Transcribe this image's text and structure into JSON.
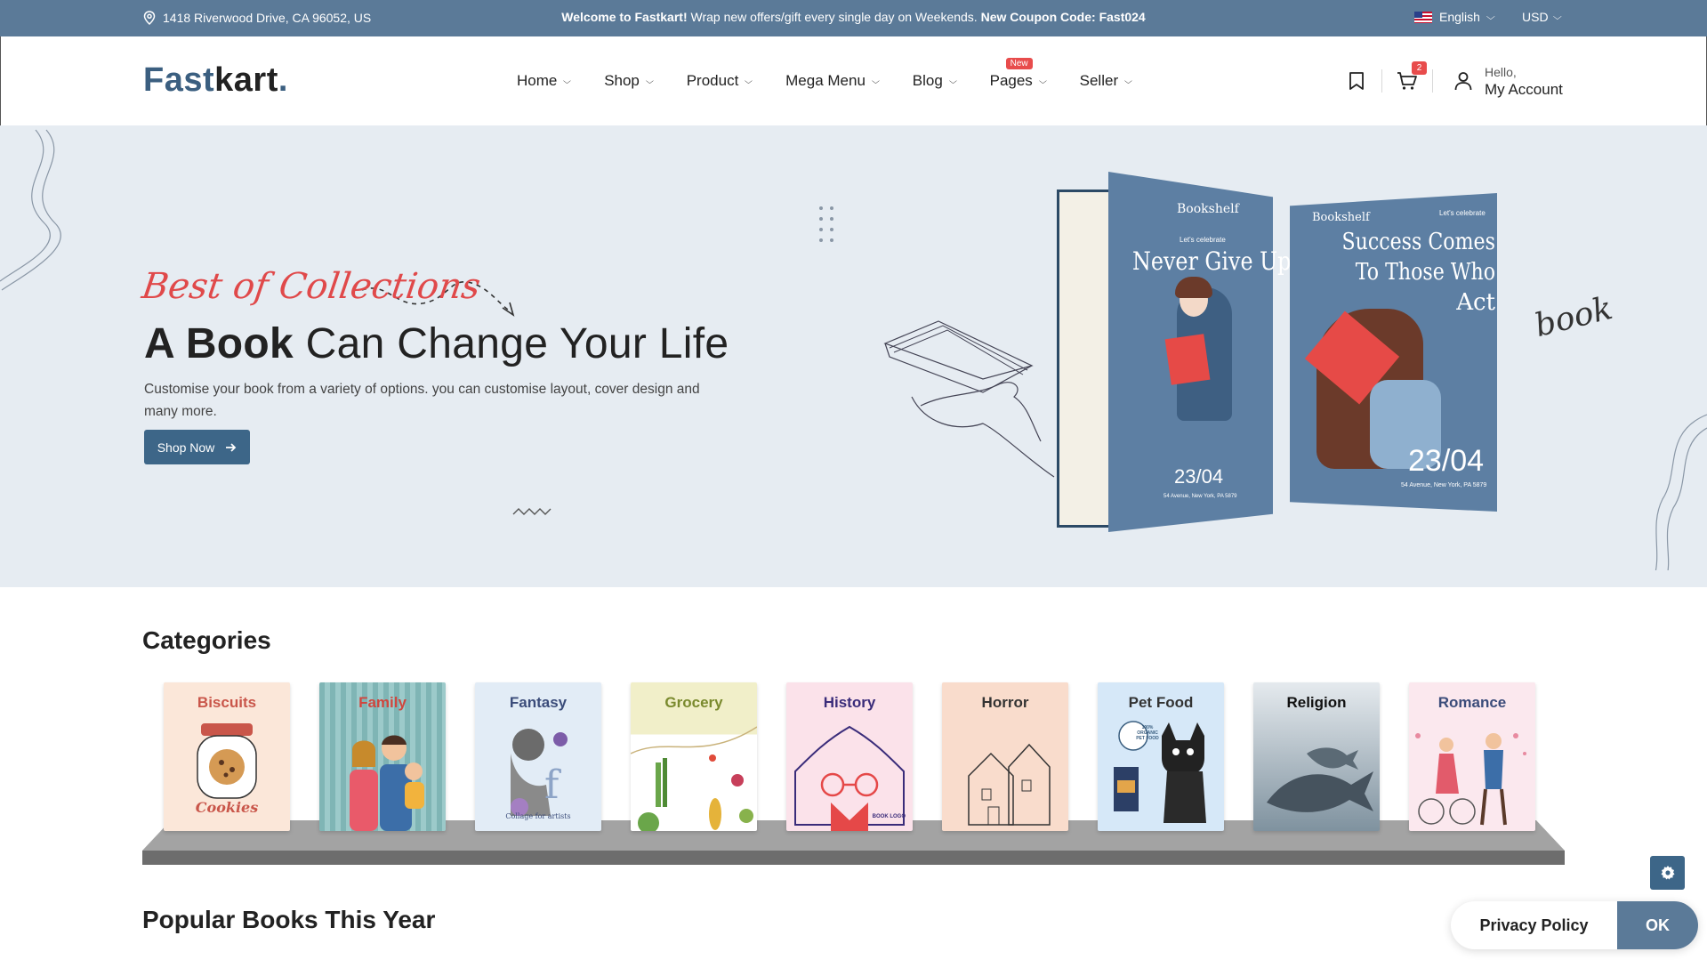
{
  "topbar": {
    "address": "1418 Riverwood Drive, CA 96052, US",
    "promo_bold": "Welcome to Fastkart!",
    "promo_text": "Wrap new offers/gift every single day on Weekends.",
    "promo_coupon": "New Coupon Code: Fast024",
    "language": "English",
    "currency": "USD"
  },
  "header": {
    "logo_part1": "Fast",
    "logo_part2": "kart",
    "logo_dot": ".",
    "nav": [
      {
        "label": "Home"
      },
      {
        "label": "Shop"
      },
      {
        "label": "Product"
      },
      {
        "label": "Mega Menu"
      },
      {
        "label": "Blog"
      },
      {
        "label": "Pages",
        "badge": "New"
      },
      {
        "label": "Seller"
      }
    ],
    "cart_count": "2",
    "account_hello": "Hello,",
    "account_label": "My Account"
  },
  "hero": {
    "script": "Best of Collections",
    "title_bold": "A Book",
    "title_rest": "Can Change Your Life",
    "description": "Customise your book from a variety of options. you can customise layout, cover design and many more.",
    "button": "Shop Now",
    "book1": {
      "brand": "Bookshelf",
      "tag": "Let's celebrate",
      "title": "Never Give Up",
      "date": "23/04",
      "address": "54 Avenue, New York, PA 5879"
    },
    "book2": {
      "brand": "Bookshelf",
      "tag": "Let's celebrate",
      "title_line1": "Success Comes",
      "title_line2": "To Those Who",
      "title_line3": "Act",
      "date": "23/04",
      "address": "54 Avenue, New York, PA 5879"
    },
    "side_word": "book"
  },
  "categories": {
    "title": "Categories",
    "items": [
      {
        "label": "Biscuits",
        "art_text": "Cookies",
        "color": "#c9564a"
      },
      {
        "label": "Family",
        "art_text": "",
        "color": "#d0463e"
      },
      {
        "label": "Fantasy",
        "art_text": "Collage for artists",
        "color": "#3b4c7a"
      },
      {
        "label": "Grocery",
        "art_text": "",
        "color": "#7a8a2e"
      },
      {
        "label": "History",
        "art_text": "BOOK LOGO",
        "color": "#3a2c7a"
      },
      {
        "label": "Horror",
        "art_text": "",
        "color": "#333333"
      },
      {
        "label": "Pet Food",
        "art_text": "100% ORGANIC PET FOOD",
        "color": "#333333"
      },
      {
        "label": "Religion",
        "art_text": "",
        "color": "#111111"
      },
      {
        "label": "Romance",
        "art_text": "",
        "color": "#3b4c7a"
      }
    ]
  },
  "popular": {
    "title": "Popular Books This Year"
  },
  "cookie": {
    "privacy": "Privacy Policy",
    "ok": "OK"
  },
  "colors": {
    "topbar": "#5b7a98",
    "accent": "#3d6688",
    "hero_bg": "#e6ecf2",
    "badge": "#e84c4c"
  },
  "icons": [
    "location-icon",
    "flag-icon",
    "bookmark-icon",
    "cart-icon",
    "user-icon",
    "arrow-right-icon",
    "gear-icon"
  ]
}
